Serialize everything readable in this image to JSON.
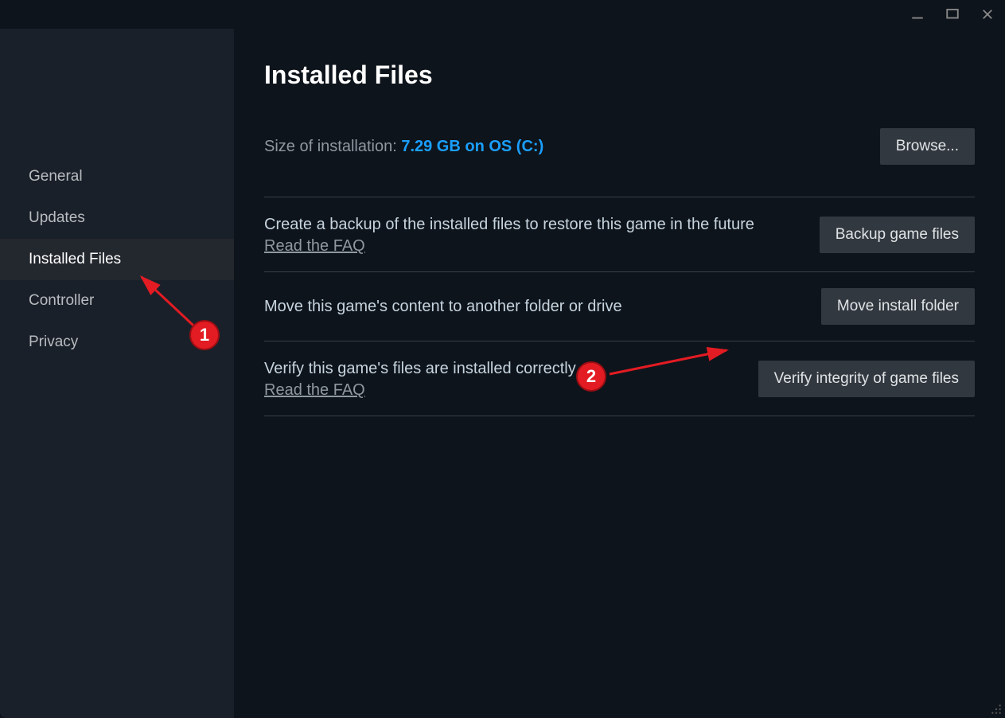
{
  "window": {
    "minimize_tooltip": "Minimize",
    "maximize_tooltip": "Maximize",
    "close_tooltip": "Close"
  },
  "sidebar": {
    "items": [
      {
        "label": "General",
        "active": false
      },
      {
        "label": "Updates",
        "active": false
      },
      {
        "label": "Installed Files",
        "active": true
      },
      {
        "label": "Controller",
        "active": false
      },
      {
        "label": "Privacy",
        "active": false
      }
    ]
  },
  "main": {
    "title": "Installed Files",
    "size_label": "Size of installation: ",
    "size_value": "7.29 GB on OS (C:)",
    "browse_button": "Browse...",
    "sections": {
      "backup": {
        "desc": "Create a backup of the installed files to restore this game in the future",
        "faq": "Read the FAQ",
        "button": "Backup game files"
      },
      "move": {
        "desc": "Move this game's content to another folder or drive",
        "button": "Move install folder"
      },
      "verify": {
        "desc": "Verify this game's files are installed correctly",
        "faq": "Read the FAQ",
        "button": "Verify integrity of game files"
      }
    }
  },
  "annotations": {
    "marker1": "1",
    "marker2": "2"
  }
}
